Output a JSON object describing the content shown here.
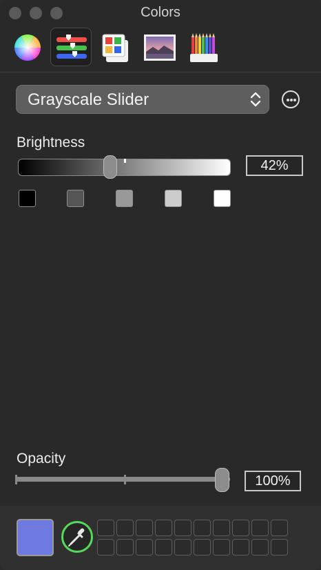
{
  "window": {
    "title": "Colors"
  },
  "toolbar": {
    "tabs": [
      {
        "name": "color-wheel",
        "icon": "color-wheel-icon",
        "active": false
      },
      {
        "name": "color-sliders",
        "icon": "sliders-icon",
        "active": true
      },
      {
        "name": "color-palettes",
        "icon": "palette-icon",
        "active": false
      },
      {
        "name": "image-palettes",
        "icon": "image-icon",
        "active": false
      },
      {
        "name": "pencils",
        "icon": "pencils-icon",
        "active": false
      }
    ]
  },
  "slider_mode": {
    "selected": "Grayscale Slider"
  },
  "brightness": {
    "label": "Brightness",
    "value_text": "42%",
    "value": 0.42
  },
  "grayscale_swatches": [
    {
      "color": "#000000"
    },
    {
      "color": "#555555"
    },
    {
      "color": "#999999"
    },
    {
      "color": "#cccccc"
    },
    {
      "color": "#ffffff"
    }
  ],
  "opacity": {
    "label": "Opacity",
    "value_text": "100%",
    "value": 1.0
  },
  "current_color": "#6f7ae0",
  "accent_colors": {
    "eyedropper_ring": "#55d95a"
  }
}
